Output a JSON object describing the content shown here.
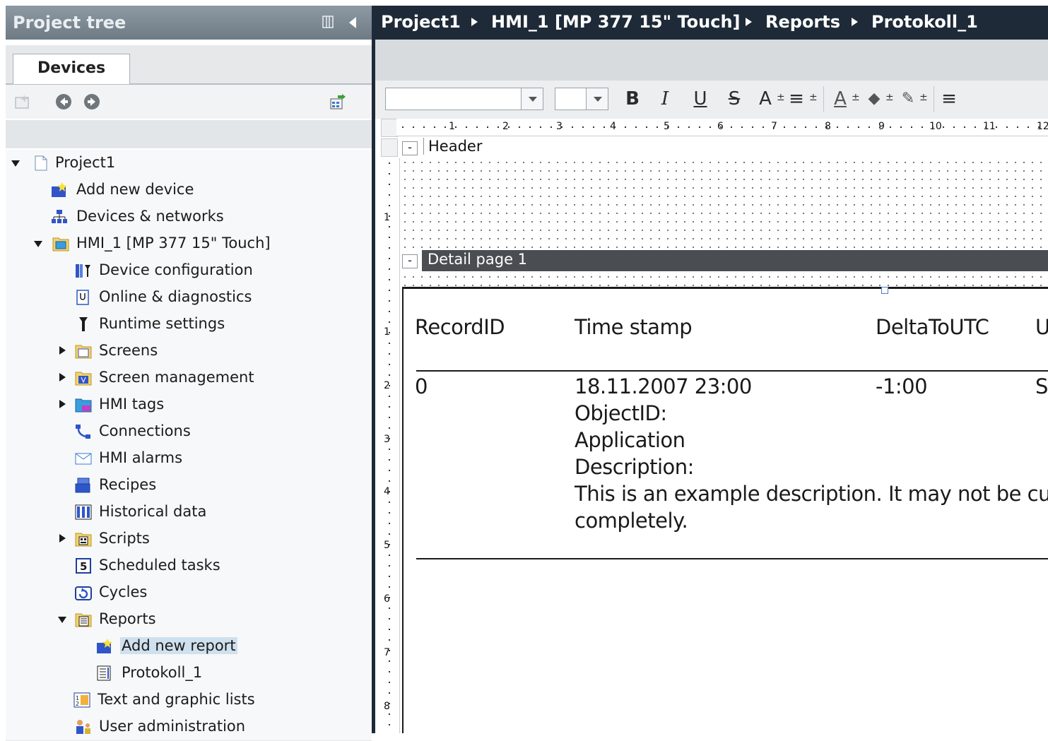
{
  "tree": {
    "title": "Project tree",
    "tab": "Devices",
    "items": [
      {
        "label": "Project1"
      },
      {
        "label": "Add new device"
      },
      {
        "label": "Devices & networks"
      },
      {
        "label": "HMI_1 [MP 377 15\" Touch]"
      },
      {
        "label": "Device configuration"
      },
      {
        "label": "Online & diagnostics"
      },
      {
        "label": "Runtime settings"
      },
      {
        "label": "Screens"
      },
      {
        "label": "Screen management"
      },
      {
        "label": "HMI tags"
      },
      {
        "label": "Connections"
      },
      {
        "label": "HMI alarms"
      },
      {
        "label": "Recipes"
      },
      {
        "label": "Historical data"
      },
      {
        "label": "Scripts"
      },
      {
        "label": "Scheduled tasks"
      },
      {
        "label": "Cycles"
      },
      {
        "label": "Reports"
      },
      {
        "label": "Add new report"
      },
      {
        "label": "Protokoll_1"
      },
      {
        "label": "Text and graphic lists"
      },
      {
        "label": "User administration"
      }
    ]
  },
  "breadcrumb": [
    "Project1",
    "HMI_1 [MP 377 15\" Touch]",
    "Reports",
    "Protokoll_1"
  ],
  "toolbar": {
    "bold": "B",
    "italic": "I",
    "underline": "U",
    "strike": "S",
    "font_size": "A",
    "align": "≡",
    "font_color": "A",
    "fill": "◆",
    "line": "✎",
    "more": "≡",
    "plusminus": "±"
  },
  "ruler": {
    "h_numbers": [
      "1",
      "2",
      "3",
      "4",
      "5",
      "6",
      "7",
      "8",
      "9",
      "10",
      "11",
      "12"
    ],
    "v_numbers": [
      "1",
      "1",
      "2",
      "3",
      "4",
      "5",
      "6",
      "7",
      "8"
    ]
  },
  "sections": {
    "header": "Header",
    "detail": "Detail page 1"
  },
  "report": {
    "headers": {
      "record_id": "RecordID",
      "time_stamp": "Time stamp",
      "delta": "DeltaToUTC",
      "extra": "U"
    },
    "row": {
      "record_id": "0",
      "time_stamp": "18.11.2007 23:00",
      "delta": "-1:00",
      "extra": "S",
      "object_id": "ObjectID:",
      "application": "Application",
      "description_label": "Description:",
      "description_line1": "This is an example description. It may not be cu",
      "description_line2": "completely."
    }
  },
  "colors": {
    "tree_title": "#7b8790",
    "breadcrumb_bg": "#1e2a38",
    "detail_bar": "#4a4e52",
    "selection": "#cfe0ee"
  }
}
